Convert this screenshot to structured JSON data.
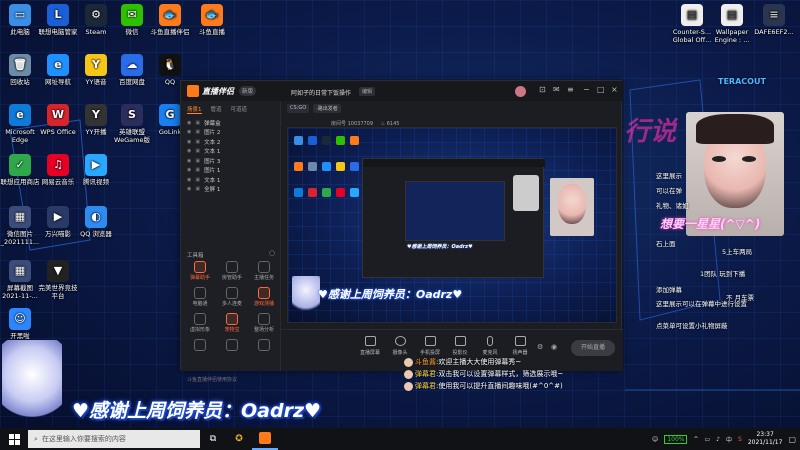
{
  "desktop": {
    "icons": [
      {
        "label": "此电脑",
        "color": "#3a8ee6",
        "glyph": "▭",
        "icon": "computer-icon"
      },
      {
        "label": "联想电脑管家",
        "color": "#1a5fd6",
        "glyph": "L",
        "icon": "lenovo-icon"
      },
      {
        "label": "Steam",
        "color": "#1b2838",
        "glyph": "⚙",
        "icon": "steam-icon"
      },
      {
        "label": "微信",
        "color": "#2dc100",
        "glyph": "✉",
        "icon": "wechat-icon"
      },
      {
        "label": "斗鱼直播伴侣",
        "color": "#ff7a1a",
        "glyph": "🐟",
        "icon": "douyu-companion-icon"
      },
      {
        "label": "斗鱼直播",
        "color": "#ff7a1a",
        "glyph": "🐟",
        "icon": "douyu-live-icon"
      },
      {
        "label": "回收站",
        "color": "#6d8aa8",
        "glyph": "🗑",
        "icon": "recycle-bin-icon"
      },
      {
        "label": "网址导航",
        "color": "#1e90ff",
        "glyph": "e",
        "icon": "ie-browser-icon"
      },
      {
        "label": "YY语音",
        "color": "#f5c518",
        "glyph": "Y",
        "icon": "yy-voice-icon"
      },
      {
        "label": "百度网盘",
        "color": "#2a6be8",
        "glyph": "☁",
        "icon": "baidu-pan-icon"
      },
      {
        "label": "QQ",
        "color": "#111",
        "glyph": "🐧",
        "icon": "qq-icon"
      },
      {
        "label": "Microsoft Edge",
        "color": "#0f7bd8",
        "glyph": "e",
        "icon": "edge-icon"
      },
      {
        "label": "WPS Office",
        "color": "#d7252b",
        "glyph": "W",
        "icon": "wps-icon"
      },
      {
        "label": "YY开播",
        "color": "#333",
        "glyph": "Y",
        "icon": "yy-live-icon"
      },
      {
        "label": "英雄联盟WeGame版",
        "color": "#2b2d5c",
        "glyph": "S",
        "icon": "lol-icon"
      },
      {
        "label": "GoLink",
        "color": "#1a7ff0",
        "glyph": "G",
        "icon": "golink-icon"
      },
      {
        "label": "联想应用商店",
        "color": "#2ea84a",
        "glyph": "✓",
        "icon": "app-store-icon"
      },
      {
        "label": "网易云音乐",
        "color": "#e60026",
        "glyph": "♫",
        "icon": "netease-music-icon"
      },
      {
        "label": "腾讯视频",
        "color": "#2aa7ff",
        "glyph": "▶",
        "icon": "tencent-video-icon"
      },
      {
        "label": "微信图片_2021111...",
        "color": "#3b4b7a",
        "glyph": "▦",
        "icon": "image-file-icon"
      },
      {
        "label": "万兴喵影",
        "color": "#2a3a66",
        "glyph": "▶",
        "icon": "filmora-icon"
      },
      {
        "label": "QQ 浏览器",
        "color": "#2d8cf0",
        "glyph": "◐",
        "icon": "qq-browser-icon"
      },
      {
        "label": "屏幕截图 2021-11-...",
        "color": "#3b4b7a",
        "glyph": "▦",
        "icon": "screenshot-file-icon"
      },
      {
        "label": "完美世界竞技平台",
        "color": "#222",
        "glyph": "▼",
        "icon": "perfect-world-icon"
      },
      {
        "label": "开黑啦",
        "color": "#2c86ff",
        "glyph": "☺",
        "icon": "kaiheila-icon"
      }
    ],
    "right_icons": [
      {
        "label": "Counter-S... Global Off...",
        "icon": "csgo-file-icon"
      },
      {
        "label": "Wallpaper Engine : ...",
        "icon": "wallpaper-engine-icon"
      },
      {
        "label": "DAFE6EF2...",
        "icon": "text-file-icon"
      }
    ]
  },
  "app": {
    "brand": "直播伴侣",
    "version_chip": "新版",
    "stream_title": "阿如子的日常下饭操作",
    "edit_chip": "编辑",
    "room_tabs": [
      "CS:GO",
      "·路出发者"
    ],
    "room_info": "房间号 10037709",
    "views": "6145",
    "side_tabs": [
      "场景1",
      "管道",
      "可道道"
    ],
    "layers": [
      "弹幕盒",
      "图片 2",
      "文本 2",
      "文本 1",
      "图片 3",
      "图片 1",
      "文本 1",
      "全屏 1"
    ],
    "tool_header": "工具箱",
    "tools": [
      "弹幕助手",
      "房管助手",
      "主播任务",
      "电脑通",
      "多人连麦",
      "游戏测播",
      "虚拟形象",
      "宠物宝",
      "整场分析",
      "",
      "",
      ""
    ],
    "sidebar_footer": "斗鱼直播伴侣使用协议",
    "bottom_buttons": [
      "直播屏幕",
      "摄像头",
      "手机投屏",
      "投影仪",
      "麦克风",
      "扬声器"
    ],
    "start_live": "开始直播"
  },
  "overlay": {
    "thanks_text": "♥感谢上周饲养员：Oadrz♥",
    "right_wish": "想要一星星(^▽^)",
    "teaser": "TERACOUT"
  },
  "chat": [
    {
      "name": "斗鱼酱",
      "text": "欢迎主播大大使用弹幕秀~"
    },
    {
      "name": "弹幕君",
      "text": "双击我可以设置弹幕样式，筛选展示哦~"
    },
    {
      "name": "弹幕君",
      "text": "使用我可以提升直播间趣味哦(#^0^#)"
    }
  ],
  "right_side_lines": [
    "这里展示",
    "可以在弹",
    "礼物、诸如",
    "石上面",
    "5上车两局",
    "1团队  玩到下播",
    "不  月车票",
    "添加弹幕",
    "这里展示可以在弹幕中进行设置",
    "点菜单可设置小礼物屏蔽"
  ],
  "taskbar": {
    "search_placeholder": "在这里输入你要搜索的内容",
    "battery": "100%",
    "ime": "中",
    "time": "23:37",
    "date": "2021/11/17"
  }
}
